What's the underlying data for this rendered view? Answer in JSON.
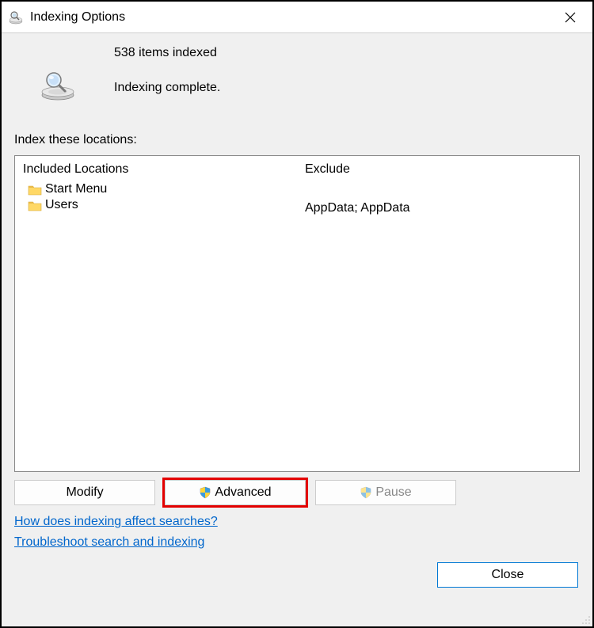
{
  "window": {
    "title": "Indexing Options"
  },
  "status": {
    "items_indexed": "538 items indexed",
    "completion": "Indexing complete."
  },
  "section": {
    "label": "Index these locations:"
  },
  "columns": {
    "included_header": "Included Locations",
    "exclude_header": "Exclude"
  },
  "included": [
    {
      "name": "Start Menu"
    },
    {
      "name": "Users"
    }
  ],
  "excluded": [
    {
      "text": ""
    },
    {
      "text": "AppData; AppData"
    }
  ],
  "buttons": {
    "modify": "Modify",
    "advanced": "Advanced",
    "pause": "Pause",
    "close": "Close"
  },
  "links": {
    "how_affect": "How does indexing affect searches?",
    "troubleshoot": "Troubleshoot search and indexing"
  }
}
